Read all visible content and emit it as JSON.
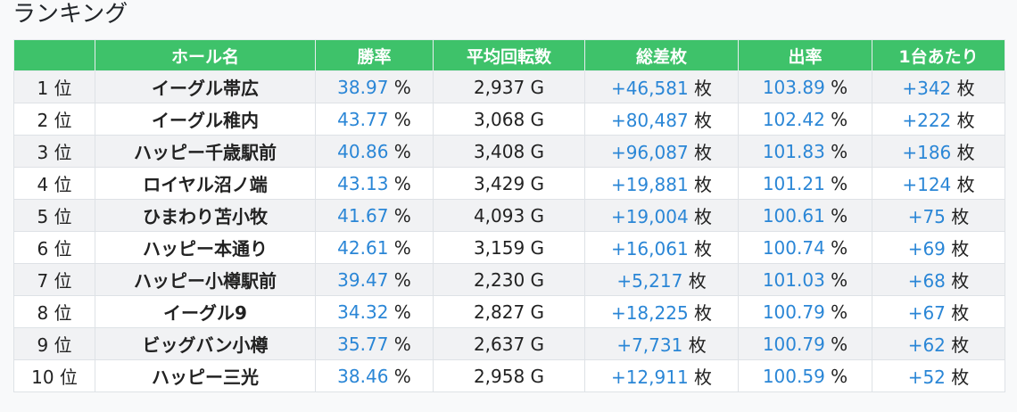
{
  "title": "ランキング",
  "columns": [
    "",
    "ホール名",
    "勝率",
    "平均回転数",
    "総差枚",
    "出率",
    "1台あたり"
  ],
  "rows": [
    {
      "rank": "1 位",
      "hall": "イーグル帯広",
      "win_rate": "38.97",
      "spins": "2,937 G",
      "total": "+46,581",
      "payout": "103.89",
      "per_machine": "+342"
    },
    {
      "rank": "2 位",
      "hall": "イーグル稚内",
      "win_rate": "43.77",
      "spins": "3,068 G",
      "total": "+80,487",
      "payout": "102.42",
      "per_machine": "+222"
    },
    {
      "rank": "3 位",
      "hall": "ハッピー千歳駅前",
      "win_rate": "40.86",
      "spins": "3,408 G",
      "total": "+96,087",
      "payout": "101.83",
      "per_machine": "+186"
    },
    {
      "rank": "4 位",
      "hall": "ロイヤル沼ノ端",
      "win_rate": "43.13",
      "spins": "3,429 G",
      "total": "+19,881",
      "payout": "101.21",
      "per_machine": "+124"
    },
    {
      "rank": "5 位",
      "hall": "ひまわり苫小牧",
      "win_rate": "41.67",
      "spins": "4,093 G",
      "total": "+19,004",
      "payout": "100.61",
      "per_machine": "+75"
    },
    {
      "rank": "6 位",
      "hall": "ハッピー本通り",
      "win_rate": "42.61",
      "spins": "3,159 G",
      "total": "+16,061",
      "payout": "100.74",
      "per_machine": "+69"
    },
    {
      "rank": "7 位",
      "hall": "ハッピー小樽駅前",
      "win_rate": "39.47",
      "spins": "2,230 G",
      "total": "+5,217",
      "payout": "101.03",
      "per_machine": "+68"
    },
    {
      "rank": "8 位",
      "hall": "イーグル9",
      "win_rate": "34.32",
      "spins": "2,827 G",
      "total": "+18,225",
      "payout": "100.79",
      "per_machine": "+67"
    },
    {
      "rank": "9 位",
      "hall": "ビッグバン小樽",
      "win_rate": "35.77",
      "spins": "2,637 G",
      "total": "+7,731",
      "payout": "100.79",
      "per_machine": "+62"
    },
    {
      "rank": "10 位",
      "hall": "ハッピー三光",
      "win_rate": "38.46",
      "spins": "2,958 G",
      "total": "+12,911",
      "payout": "100.59",
      "per_machine": "+52"
    }
  ],
  "units": {
    "percent": "%",
    "coins": "枚"
  },
  "colors": {
    "header_bg": "#3ec26a",
    "value_blue": "#2a86d6"
  }
}
